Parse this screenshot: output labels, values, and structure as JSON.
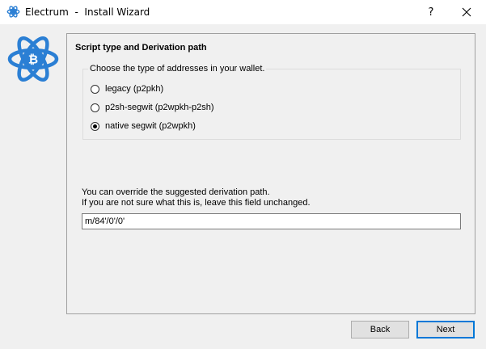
{
  "window": {
    "title": "Electrum  -  Install Wizard",
    "help_label": "?",
    "close_label": "✕"
  },
  "colors": {
    "logo_blue": "#2b7fd4",
    "accent": "#0078d7"
  },
  "icons": {
    "app": "electrum-atom-icon",
    "logo": "electrum-bitcoin-logo-icon"
  },
  "page": {
    "heading": "Script type and Derivation path",
    "group_label": "Choose the type of addresses in your wallet.",
    "options": [
      {
        "label": "legacy (p2pkh)",
        "checked": false
      },
      {
        "label": "p2sh-segwit (p2wpkh-p2sh)",
        "checked": false
      },
      {
        "label": "native segwit (p2wpkh)",
        "checked": true
      }
    ],
    "note_line1": "You can override the suggested derivation path.",
    "note_line2": "If you are not sure what this is, leave this field unchanged.",
    "derivation_path": "m/84'/0'/0'"
  },
  "buttons": {
    "back": "Back",
    "next": "Next"
  }
}
